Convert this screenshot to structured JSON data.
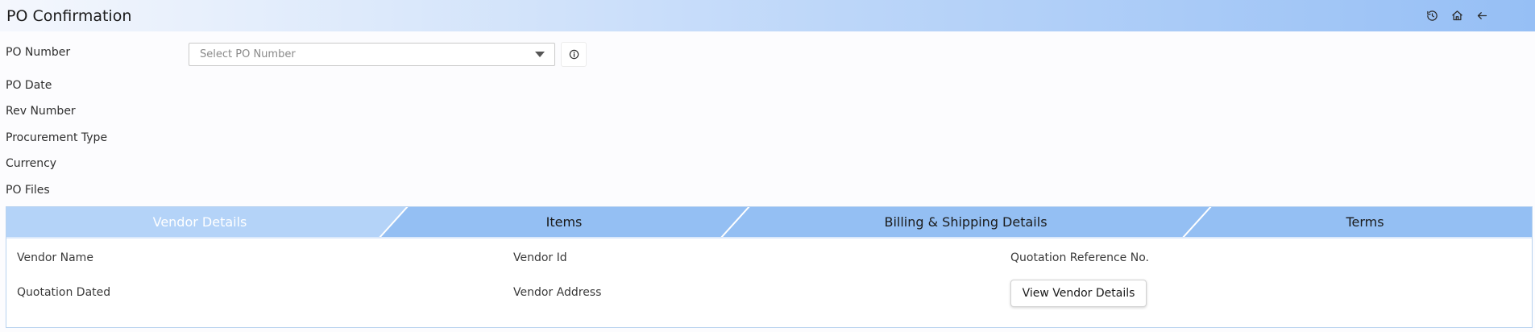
{
  "header": {
    "title": "PO Confirmation",
    "icons": [
      "history-icon",
      "home-icon",
      "back-arrow-icon"
    ]
  },
  "form": {
    "po_number_label": "PO Number",
    "po_number_placeholder": "Select PO Number",
    "po_date_label": "PO Date",
    "rev_number_label": "Rev Number",
    "procurement_type_label": "Procurement Type",
    "currency_label": "Currency",
    "po_files_label": "PO Files"
  },
  "tabs": [
    {
      "label": "Vendor Details",
      "active": true
    },
    {
      "label": "Items",
      "active": false
    },
    {
      "label": "Billing & Shipping Details",
      "active": false
    },
    {
      "label": "Terms",
      "active": false
    }
  ],
  "vendor_details": {
    "vendor_name_label": "Vendor Name",
    "vendor_id_label": "Vendor Id",
    "quotation_ref_label": "Quotation Reference No.",
    "quotation_dated_label": "Quotation Dated",
    "vendor_address_label": "Vendor Address",
    "view_button_label": "View Vendor Details"
  },
  "colors": {
    "tab_bar": "#94bff3",
    "active_tab": "#b4d3f8",
    "header_gradient_end": "#96bff5"
  }
}
